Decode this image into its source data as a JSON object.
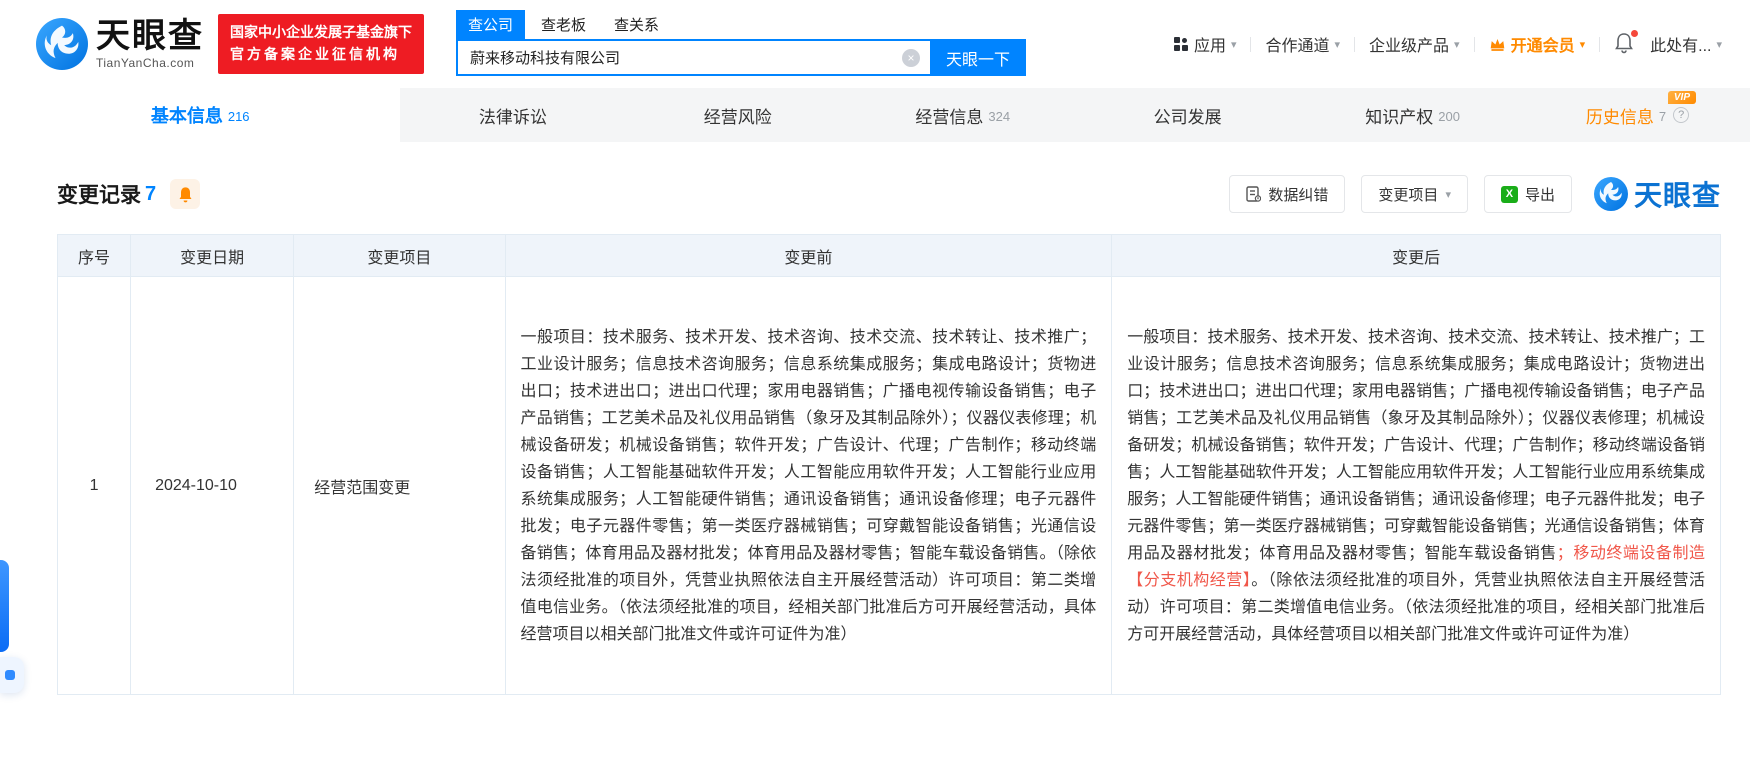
{
  "header": {
    "logo_title": "天眼查",
    "logo_sub": "TianYanCha.com",
    "badge_line1": "国家中小企业发展子基金旗下",
    "badge_line2": "官方备案企业征信机构",
    "search_tabs": [
      {
        "label": "查公司"
      },
      {
        "label": "查老板"
      },
      {
        "label": "查关系"
      }
    ],
    "search_value": "蔚来移动科技有限公司",
    "search_button": "天眼一下",
    "nav_app": "应用",
    "nav_coop": "合作通道",
    "nav_enterprise": "企业级产品",
    "nav_vip": "开通会员",
    "nav_more": "此处有..."
  },
  "tabs": [
    {
      "label": "基本信息",
      "count": "216"
    },
    {
      "label": "法律诉讼",
      "count": ""
    },
    {
      "label": "经营风险",
      "count": ""
    },
    {
      "label": "经营信息",
      "count": "324"
    },
    {
      "label": "公司发展",
      "count": ""
    },
    {
      "label": "知识产权",
      "count": "200"
    },
    {
      "label": "历史信息",
      "count": "7",
      "vip_badge": "VIP"
    }
  ],
  "section": {
    "title": "变更记录",
    "count": "7",
    "btn_correct": "数据纠错",
    "btn_filter": "变更项目",
    "btn_export": "导出",
    "watermark": "天眼查"
  },
  "table": {
    "headers": [
      "序号",
      "变更日期",
      "变更项目",
      "变更前",
      "变更后"
    ],
    "rows": [
      {
        "index": "1",
        "date": "2024-10-10",
        "item": "经营范围变更",
        "before": "一般项目：技术服务、技术开发、技术咨询、技术交流、技术转让、技术推广；工业设计服务；信息技术咨询服务；信息系统集成服务；集成电路设计；货物进出口；技术进出口；进出口代理；家用电器销售；广播电视传输设备销售；电子产品销售；工艺美术品及礼仪用品销售（象牙及其制品除外）；仪器仪表修理；机械设备研发；机械设备销售；软件开发；广告设计、代理；广告制作；移动终端设备销售；人工智能基础软件开发；人工智能应用软件开发；人工智能行业应用系统集成服务；人工智能硬件销售；通讯设备销售；通讯设备修理；电子元器件批发；电子元器件零售；第一类医疗器械销售；可穿戴智能设备销售；光通信设备销售；体育用品及器材批发；体育用品及器材零售；智能车载设备销售。（除依法须经批准的项目外，凭营业执照依法自主开展经营活动）许可项目：第二类增值电信业务。（依法须经批准的项目，经相关部门批准后方可开展经营活动，具体经营项目以相关部门批准文件或许可证件为准）",
        "after_part1": "一般项目：技术服务、技术开发、技术咨询、技术交流、技术转让、技术推广；工业设计服务；信息技术咨询服务；信息系统集成服务；集成电路设计；货物进出口；技术进出口；进出口代理；家用电器销售；广播电视传输设备销售；电子产品销售；工艺美术品及礼仪用品销售（象牙及其制品除外）；仪器仪表修理；机械设备研发；机械设备销售；软件开发；广告设计、代理；广告制作；移动终端设备销售；人工智能基础软件开发；人工智能应用软件开发；人工智能行业应用系统集成服务；人工智能硬件销售；通讯设备销售；通讯设备修理；电子元器件批发；电子元器件零售；第一类医疗器械销售；可穿戴智能设备销售；光通信设备销售；体育用品及器材批发；体育用品及器材零售；智能车载设备销售",
        "after_highlight": "；移动终端设备制造【分支机构经营】",
        "after_part2": "。（除依法须经批准的项目外，凭营业执照依法自主开展经营活动）许可项目：第二类增值电信业务。（依法须经批准的项目，经相关部门批准后方可开展经营活动，具体经营项目以相关部门批准文件或许可证件为准）"
      }
    ]
  },
  "icons": {
    "caret": "▾",
    "close": "×",
    "question": "?",
    "excel": "X"
  },
  "colors": {
    "accent_blue": "#0084ff",
    "badge_red": "#ee1c23",
    "vip_orange": "#ff8a00",
    "highlight_red": "#f0574a",
    "excel_green": "#1aad19",
    "table_header_bg": "#eff4fa"
  }
}
